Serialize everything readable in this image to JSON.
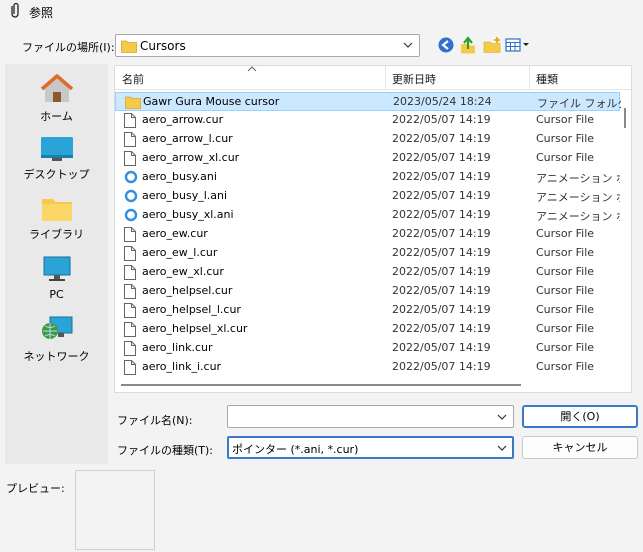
{
  "window": {
    "title": "参照"
  },
  "lookin": {
    "label": "ファイルの場所(I):",
    "value": "Cursors"
  },
  "toolbar": [
    {
      "icon": "back-icon"
    },
    {
      "icon": "up-folder-icon"
    },
    {
      "icon": "new-folder-icon"
    },
    {
      "icon": "view-menu-icon"
    }
  ],
  "places": [
    {
      "label": "ホーム",
      "icon": "home-icon"
    },
    {
      "label": "デスクトップ",
      "icon": "desktop-icon"
    },
    {
      "label": "ライブラリ",
      "icon": "library-icon"
    },
    {
      "label": "PC",
      "icon": "pc-icon"
    },
    {
      "label": "ネットワーク",
      "icon": "network-icon"
    }
  ],
  "columns": {
    "name": "名前",
    "date": "更新日時",
    "type": "種類"
  },
  "files": [
    {
      "name": "Gawr Gura Mouse cursor",
      "date": "2023/05/24 18:24",
      "type": "ファイル フォルダー",
      "kind": "folder",
      "selected": true
    },
    {
      "name": "aero_arrow.cur",
      "date": "2022/05/07 14:19",
      "type": "Cursor File",
      "kind": "file"
    },
    {
      "name": "aero_arrow_l.cur",
      "date": "2022/05/07 14:19",
      "type": "Cursor File",
      "kind": "file"
    },
    {
      "name": "aero_arrow_xl.cur",
      "date": "2022/05/07 14:19",
      "type": "Cursor File",
      "kind": "file"
    },
    {
      "name": "aero_busy.ani",
      "date": "2022/05/07 14:19",
      "type": "アニメーション ポインター",
      "kind": "ani"
    },
    {
      "name": "aero_busy_l.ani",
      "date": "2022/05/07 14:19",
      "type": "アニメーション ポインター",
      "kind": "ani"
    },
    {
      "name": "aero_busy_xl.ani",
      "date": "2022/05/07 14:19",
      "type": "アニメーション ポインター",
      "kind": "ani"
    },
    {
      "name": "aero_ew.cur",
      "date": "2022/05/07 14:19",
      "type": "Cursor File",
      "kind": "file"
    },
    {
      "name": "aero_ew_l.cur",
      "date": "2022/05/07 14:19",
      "type": "Cursor File",
      "kind": "file"
    },
    {
      "name": "aero_ew_xl.cur",
      "date": "2022/05/07 14:19",
      "type": "Cursor File",
      "kind": "file"
    },
    {
      "name": "aero_helpsel.cur",
      "date": "2022/05/07 14:19",
      "type": "Cursor File",
      "kind": "file"
    },
    {
      "name": "aero_helpsel_l.cur",
      "date": "2022/05/07 14:19",
      "type": "Cursor File",
      "kind": "file"
    },
    {
      "name": "aero_helpsel_xl.cur",
      "date": "2022/05/07 14:19",
      "type": "Cursor File",
      "kind": "file"
    },
    {
      "name": "aero_link.cur",
      "date": "2022/05/07 14:19",
      "type": "Cursor File",
      "kind": "file"
    },
    {
      "name": "aero_link_i.cur",
      "date": "2022/05/07 14:19",
      "type": "Cursor File",
      "kind": "file"
    }
  ],
  "filename": {
    "label": "ファイル名(N):",
    "value": ""
  },
  "filetype": {
    "label": "ファイルの種類(T):",
    "value": "ポインター (*.ani, *.cur)"
  },
  "buttons": {
    "open": "開く(O)",
    "cancel": "キャンセル"
  },
  "preview": {
    "label": "プレビュー:"
  },
  "colors": {
    "selection_bg": "#cce8ff",
    "selection_border": "#99d1ff",
    "accent": "#3c78c8",
    "folder": "#f7c948"
  }
}
